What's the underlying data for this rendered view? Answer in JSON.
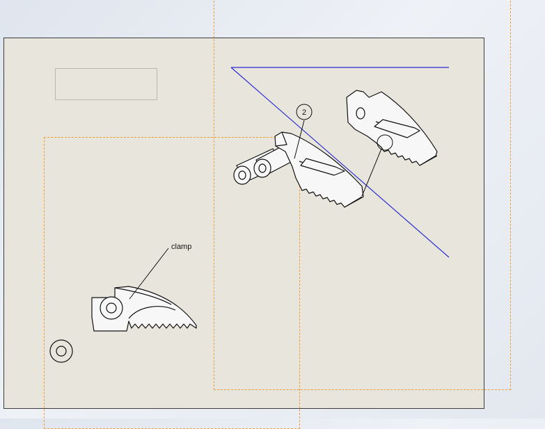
{
  "drawing": {
    "balloon_number": "2",
    "note_label": "clamp"
  },
  "colors": {
    "sheet_background": "#e8e6dc",
    "view_boundary": "#f39a3b",
    "section_line": "#2b2bd6",
    "outline": "#1a1a1a"
  }
}
